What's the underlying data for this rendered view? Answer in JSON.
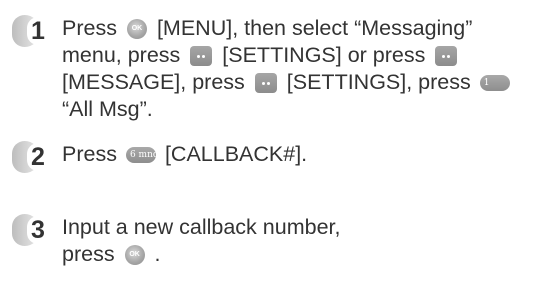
{
  "steps": [
    {
      "number": "1",
      "line1_a": "Press",
      "line1_key": "[MENU], then select “Messaging”",
      "line2_a": "menu, press",
      "line2_b": "[SETTINGS] or press",
      "line3_a": "[MESSAGE], press",
      "line3_b": "[SETTINGS], press",
      "line4": "“All Msg”."
    },
    {
      "number": "2",
      "line1_a": "Press",
      "line1_b": "[CALLBACK#]."
    },
    {
      "number": "3",
      "line1": "Input a new callback number,",
      "line2_a": "press",
      "line2_b": "."
    }
  ],
  "icons": {
    "ok_key": "ok-key-icon",
    "ok_key_label": "OK",
    "soft_key": "soft-key-icon",
    "one_key": "number-1-key-icon",
    "one_key_label": "1",
    "six_key": "number-6-key-icon",
    "six_key_label": "6 mno"
  },
  "colors": {
    "text": "#333333",
    "key_gray": "#999999"
  }
}
